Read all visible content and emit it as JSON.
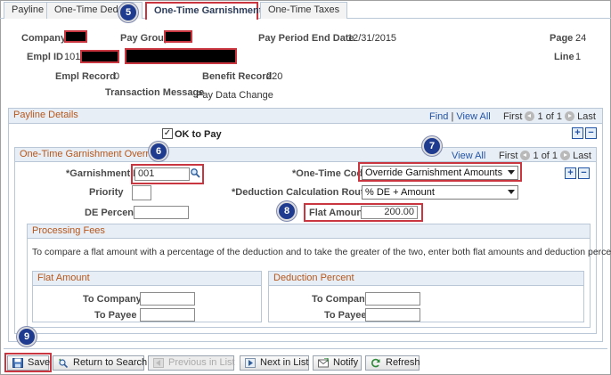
{
  "tabs": [
    {
      "label": "Payline"
    },
    {
      "label": "One-Time Deduc"
    },
    {
      "label": "One-Time Garnishments"
    },
    {
      "label": "One-Time Taxes"
    }
  ],
  "header": {
    "company_label": "Company",
    "pay_group_label": "Pay Group",
    "pay_period_end_label": "Pay Period End Date",
    "pay_period_end_value": "12/31/2015",
    "page_label": "Page",
    "page_value": "24",
    "empl_id_label": "Empl ID",
    "empl_id_value": "101",
    "line_label": "Line",
    "line_value": "1",
    "empl_record_label": "Empl Record",
    "empl_record_value": "0",
    "benefit_record_label": "Benefit Record",
    "benefit_record_value": "220",
    "transaction_message_label": "Transaction Message",
    "transaction_message_value": "Pay Data Change"
  },
  "payline_details": {
    "title": "Payline Details",
    "find": "Find",
    "separator": "|",
    "view_all": "View All",
    "first": "First",
    "range": "1 of 1",
    "last": "Last",
    "ok_to_pay_label": "OK to Pay",
    "ok_to_pay_check": "✓",
    "plus": "+",
    "minus": "−"
  },
  "override": {
    "title": "One-Time Garnishment Override",
    "view_all": "View All",
    "first": "First",
    "range": "1 of 1",
    "last": "Last",
    "garnishment_id_label": "*Garnishment ID",
    "garnishment_id_value": "001",
    "one_time_code_label": "*One-Time Code",
    "one_time_code_value": "Override Garnishment Amounts",
    "priority_label": "Priority",
    "priority_value": "",
    "deduction_routine_label": "*Deduction Calculation Routine",
    "deduction_routine_value": "% DE + Amount",
    "de_percent_label": "DE Percent",
    "de_percent_value": "",
    "flat_amount_label": "Flat Amount",
    "flat_amount_value": "200.00"
  },
  "processing_fees": {
    "title": "Processing Fees",
    "description": "To compare a flat amount with a percentage of the deduction and to take the greater of the two, enter both flat amounts and deduction percents.",
    "flat_amount_title": "Flat Amount",
    "deduction_percent_title": "Deduction Percent",
    "to_company_label": "To Company",
    "to_payee_label": "To Payee"
  },
  "toolbar": {
    "save": "Save",
    "return_to_search": "Return to Search",
    "previous_in_list": "Previous in List",
    "next_in_list": "Next in List",
    "notify": "Notify",
    "refresh": "Refresh"
  },
  "callouts": {
    "c5": "5",
    "c6": "6",
    "c7": "7",
    "c8": "8",
    "c9": "9"
  },
  "colors": {
    "highlight": "#c9363f",
    "callout": "#1f3b8f",
    "section_title": "#b5561b",
    "link": "#2254a7"
  }
}
